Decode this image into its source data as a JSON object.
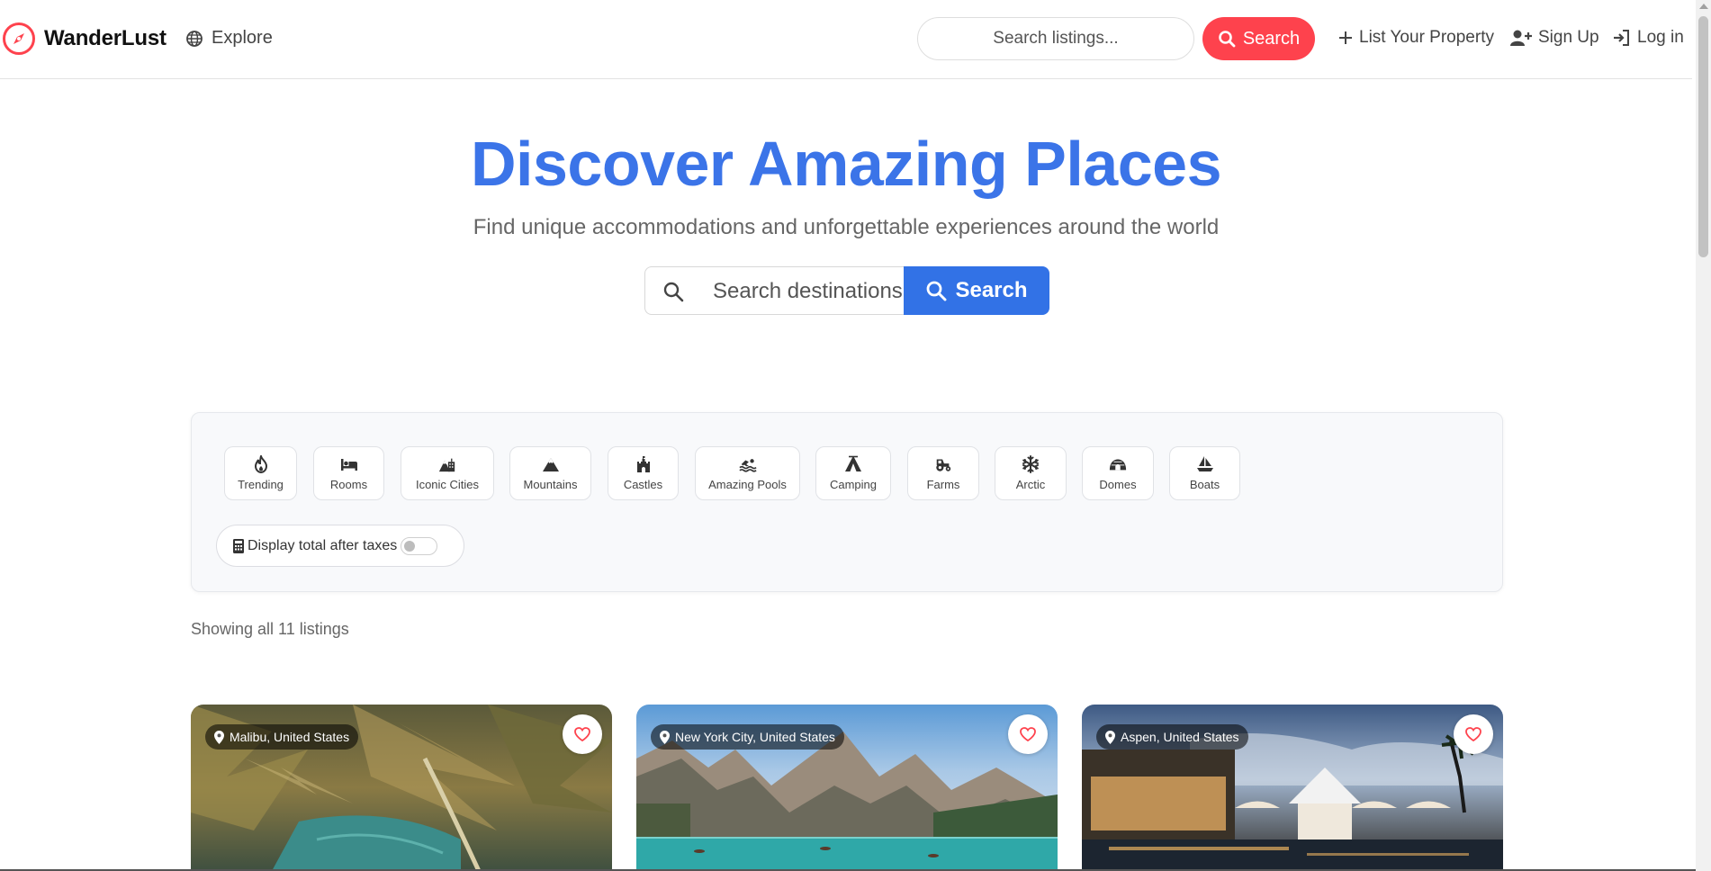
{
  "navbar": {
    "brand": "WanderLust",
    "explore": "Explore",
    "search_placeholder": "Search listings...",
    "search_button": "Search",
    "list_property": "List Your Property",
    "sign_up": "Sign Up",
    "log_in": "Log in"
  },
  "hero": {
    "title": "Discover Amazing Places",
    "subtitle": "Find unique accommodations and unforgettable experiences around the world",
    "search_placeholder": "Search destinations",
    "search_button": "Search"
  },
  "filters": [
    {
      "label": "Trending",
      "icon": "fire-icon"
    },
    {
      "label": "Rooms",
      "icon": "bed-icon"
    },
    {
      "label": "Iconic Cities",
      "icon": "city-icon"
    },
    {
      "label": "Mountains",
      "icon": "mountain-icon"
    },
    {
      "label": "Castles",
      "icon": "castle-icon"
    },
    {
      "label": "Amazing Pools",
      "icon": "swimmer-icon"
    },
    {
      "label": "Camping",
      "icon": "tent-icon"
    },
    {
      "label": "Farms",
      "icon": "tractor-icon"
    },
    {
      "label": "Arctic",
      "icon": "snowflake-icon"
    },
    {
      "label": "Domes",
      "icon": "igloo-icon"
    },
    {
      "label": "Boats",
      "icon": "sailboat-icon"
    }
  ],
  "tax_toggle": {
    "label": "Display total after taxes",
    "enabled": false
  },
  "showing_text": "Showing all 11 listings",
  "listings": [
    {
      "location": "Malibu, United States"
    },
    {
      "location": "New York City, United States"
    },
    {
      "location": "Aspen, United States"
    }
  ],
  "colors": {
    "brand_red": "#fe424d",
    "hero_blue": "#3b74e8",
    "button_blue": "#3272e6"
  }
}
